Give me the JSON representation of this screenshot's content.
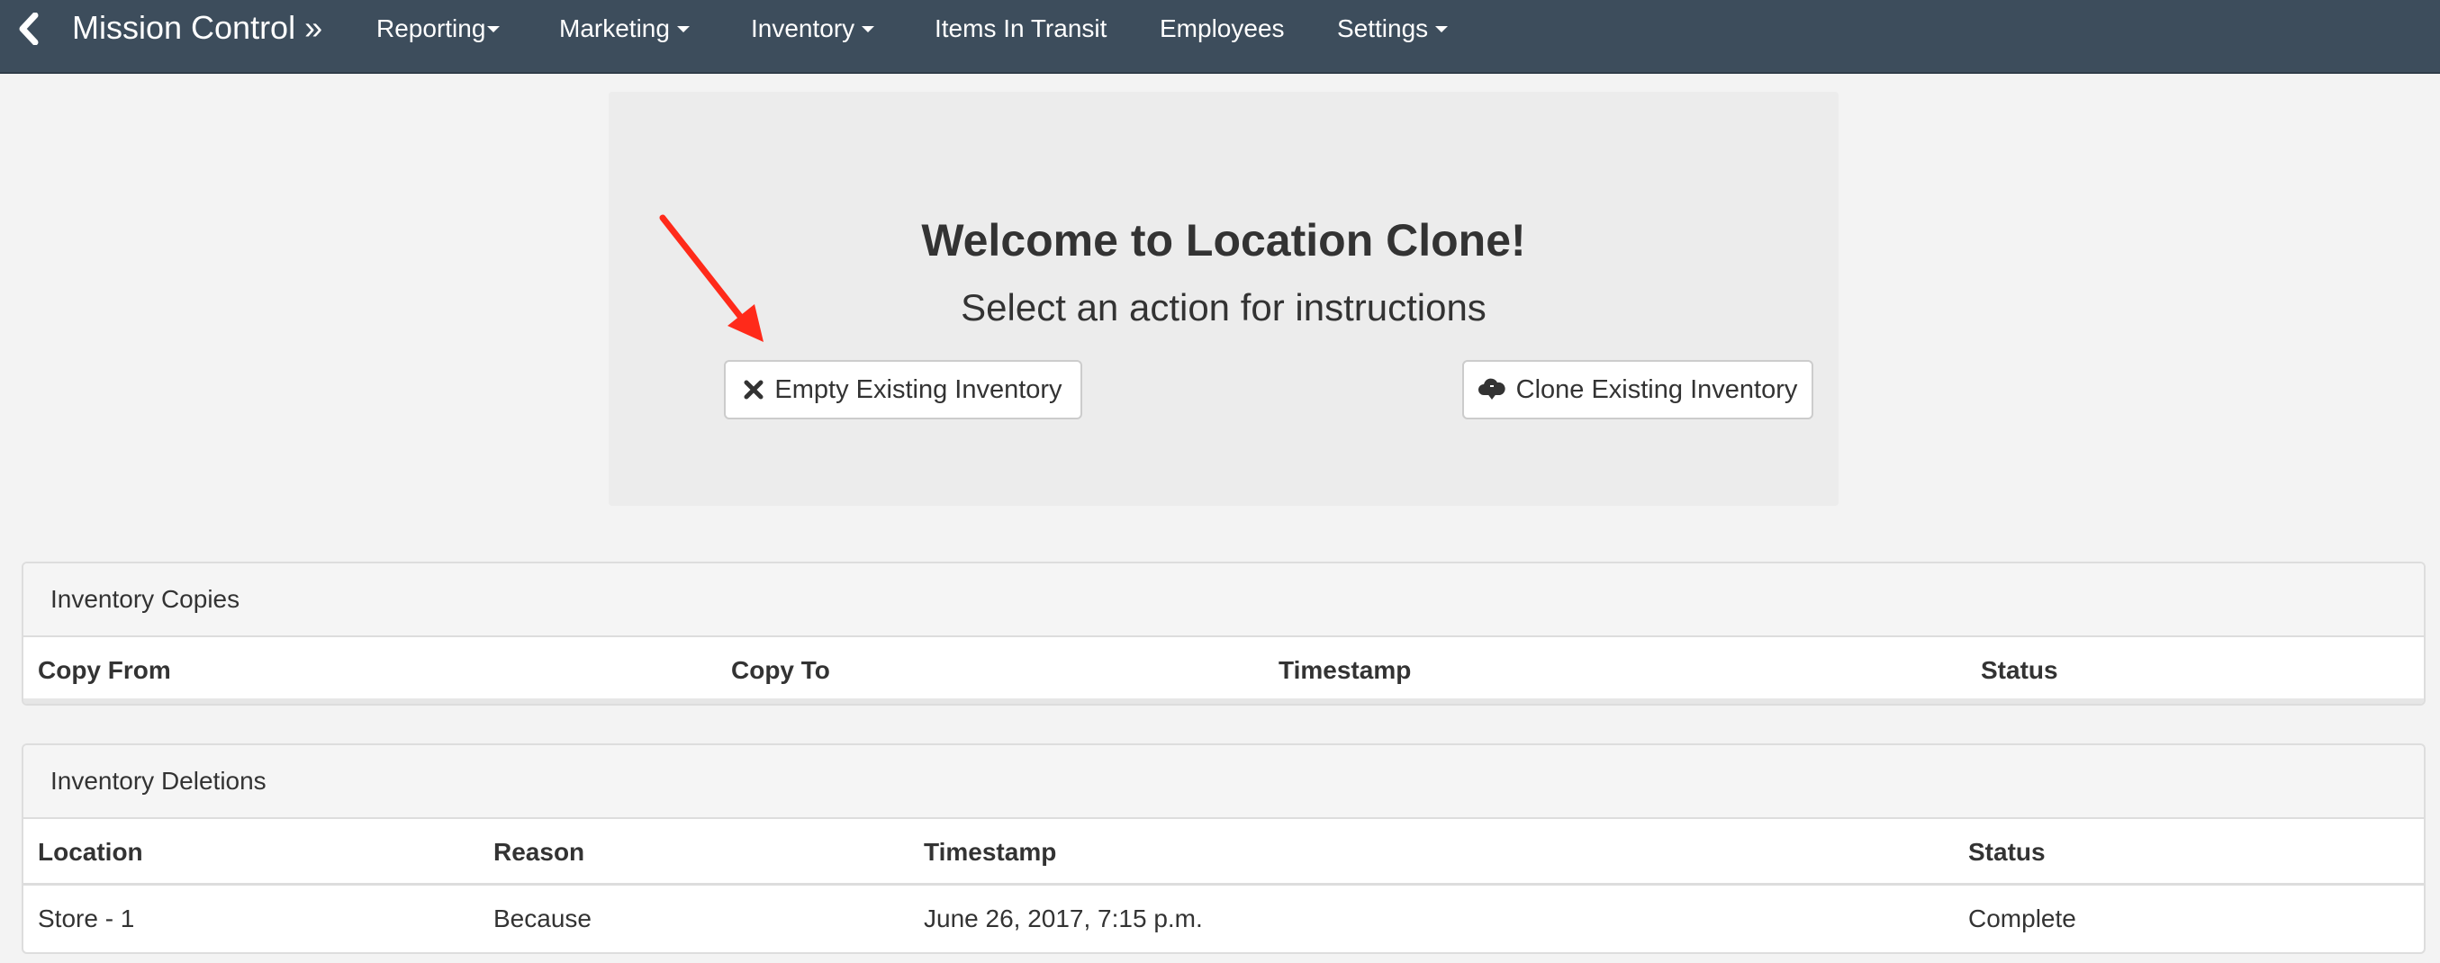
{
  "navbar": {
    "brand": "Mission Control",
    "brand_suffix": "»",
    "items": [
      {
        "label": "Reporting",
        "dropdown": true
      },
      {
        "label": "Marketing",
        "dropdown": true
      },
      {
        "label": "Inventory",
        "dropdown": true
      },
      {
        "label": "Items In Transit",
        "dropdown": false
      },
      {
        "label": "Employees",
        "dropdown": false
      },
      {
        "label": "Settings",
        "dropdown": true
      }
    ],
    "background_color": "#3d4d5c"
  },
  "jumbotron": {
    "title": "Welcome to Location Clone!",
    "subtitle": "Select an action for instructions",
    "empty_button_label": "Empty Existing Inventory",
    "empty_button_icon": "close-icon",
    "clone_button_label": "Clone Existing Inventory",
    "clone_button_icon": "cloud-download-icon"
  },
  "annotation": {
    "arrow_color": "#ff2a1a",
    "icon": "red-arrow-icon"
  },
  "inventory_copies": {
    "title": "Inventory Copies",
    "columns": [
      "Copy From",
      "Copy To",
      "Timestamp",
      "Status"
    ],
    "rows": []
  },
  "inventory_deletions": {
    "title": "Inventory Deletions",
    "columns": [
      "Location",
      "Reason",
      "Timestamp",
      "Status"
    ],
    "rows": [
      [
        "Store - 1",
        "Because",
        "June 26, 2017, 7:15 p.m.",
        "Complete"
      ]
    ]
  }
}
